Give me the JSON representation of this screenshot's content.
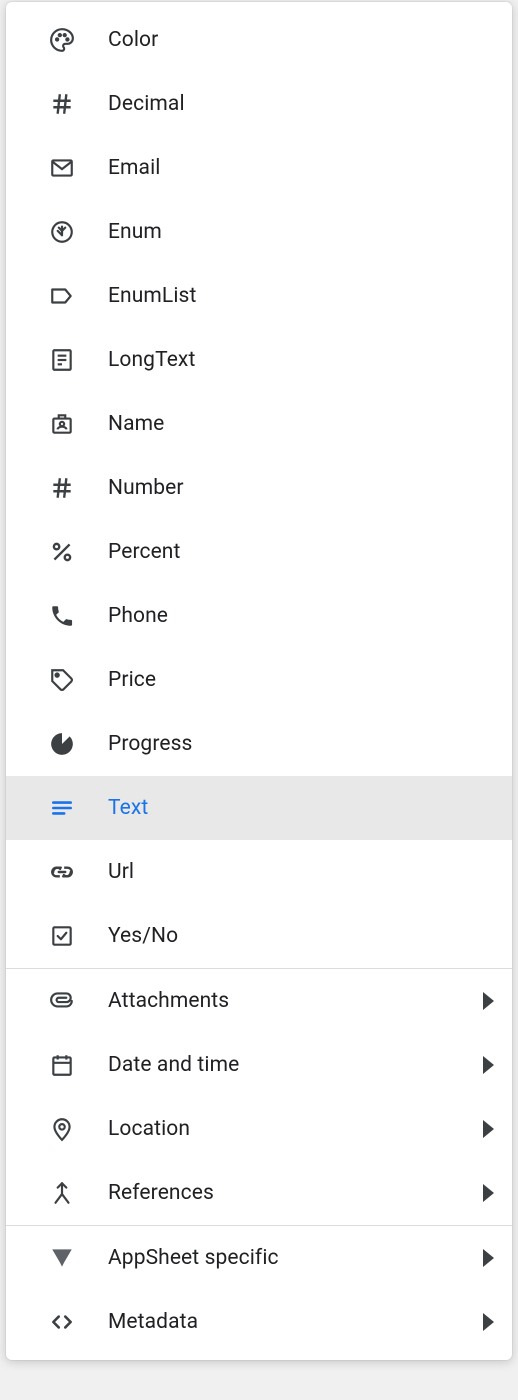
{
  "colors": {
    "accent": "#1a73e8",
    "text": "#202124",
    "divider": "#dadce0",
    "selectedBg": "#e8e8e8"
  },
  "selected": "text",
  "groups": [
    {
      "items": [
        {
          "id": "color",
          "label": "Color",
          "icon": "palette-icon"
        },
        {
          "id": "decimal",
          "label": "Decimal",
          "icon": "hash-icon"
        },
        {
          "id": "email",
          "label": "Email",
          "icon": "envelope-icon"
        },
        {
          "id": "enum",
          "label": "Enum",
          "icon": "circle-dot-icon"
        },
        {
          "id": "enumlist",
          "label": "EnumList",
          "icon": "tag-outline-icon"
        },
        {
          "id": "longtext",
          "label": "LongText",
          "icon": "article-icon"
        },
        {
          "id": "name",
          "label": "Name",
          "icon": "badge-icon"
        },
        {
          "id": "number",
          "label": "Number",
          "icon": "hash-icon"
        },
        {
          "id": "percent",
          "label": "Percent",
          "icon": "percent-icon"
        },
        {
          "id": "phone",
          "label": "Phone",
          "icon": "phone-icon"
        },
        {
          "id": "price",
          "label": "Price",
          "icon": "price-tag-icon"
        },
        {
          "id": "progress",
          "label": "Progress",
          "icon": "pie-icon"
        },
        {
          "id": "text",
          "label": "Text",
          "icon": "text-lines-icon"
        },
        {
          "id": "url",
          "label": "Url",
          "icon": "link-icon"
        },
        {
          "id": "yesno",
          "label": "Yes/No",
          "icon": "checkbox-icon"
        }
      ]
    },
    {
      "items": [
        {
          "id": "attachments",
          "label": "Attachments",
          "icon": "attachment-icon",
          "submenu": true
        },
        {
          "id": "datetime",
          "label": "Date and time",
          "icon": "calendar-icon",
          "submenu": true
        },
        {
          "id": "location",
          "label": "Location",
          "icon": "location-icon",
          "submenu": true
        },
        {
          "id": "references",
          "label": "References",
          "icon": "merge-icon",
          "submenu": true
        }
      ]
    },
    {
      "items": [
        {
          "id": "appsheet",
          "label": "AppSheet specific",
          "icon": "appsheet-icon",
          "submenu": true
        },
        {
          "id": "metadata",
          "label": "Metadata",
          "icon": "code-icon",
          "submenu": true
        }
      ]
    }
  ]
}
